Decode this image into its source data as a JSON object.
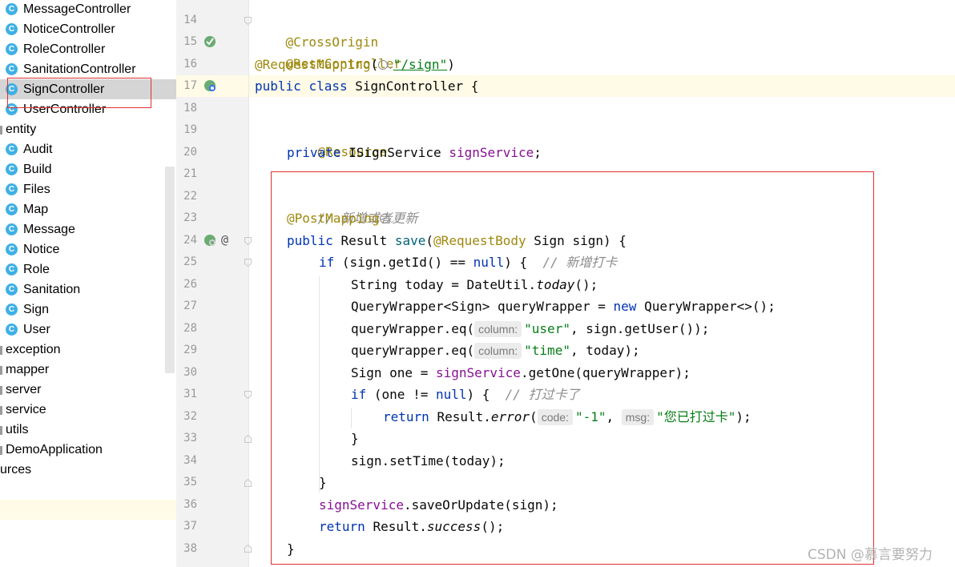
{
  "project_tree": {
    "items": [
      {
        "label": "MessageController",
        "kind": "class",
        "icon": "class-icon",
        "selected": false
      },
      {
        "label": "NoticeController",
        "kind": "class",
        "icon": "class-icon",
        "selected": false
      },
      {
        "label": "RoleController",
        "kind": "class",
        "icon": "class-icon",
        "selected": false
      },
      {
        "label": "SanitationController",
        "kind": "class",
        "icon": "class-icon",
        "selected": false
      },
      {
        "label": "SignController",
        "kind": "class",
        "icon": "class-icon",
        "selected": true
      },
      {
        "label": "UserController",
        "kind": "class",
        "icon": "class-icon",
        "selected": false
      },
      {
        "label": "entity",
        "kind": "package",
        "icon": "folder-icon",
        "selected": false
      },
      {
        "label": "Audit",
        "kind": "class",
        "icon": "class-icon",
        "selected": false
      },
      {
        "label": "Build",
        "kind": "class",
        "icon": "class-icon",
        "selected": false
      },
      {
        "label": "Files",
        "kind": "class",
        "icon": "class-icon",
        "selected": false
      },
      {
        "label": "Map",
        "kind": "class",
        "icon": "class-icon",
        "selected": false
      },
      {
        "label": "Message",
        "kind": "class",
        "icon": "class-icon",
        "selected": false
      },
      {
        "label": "Notice",
        "kind": "class",
        "icon": "class-icon",
        "selected": false
      },
      {
        "label": "Role",
        "kind": "class",
        "icon": "class-icon",
        "selected": false
      },
      {
        "label": "Sanitation",
        "kind": "class",
        "icon": "class-icon",
        "selected": false
      },
      {
        "label": "Sign",
        "kind": "class",
        "icon": "class-icon",
        "selected": false
      },
      {
        "label": "User",
        "kind": "class",
        "icon": "class-icon",
        "selected": false
      },
      {
        "label": "exception",
        "kind": "package",
        "icon": "folder-icon",
        "selected": false
      },
      {
        "label": "mapper",
        "kind": "package",
        "icon": "folder-icon",
        "selected": false
      },
      {
        "label": "server",
        "kind": "package",
        "icon": "folder-icon",
        "selected": false
      },
      {
        "label": "service",
        "kind": "package",
        "icon": "folder-icon",
        "selected": false
      },
      {
        "label": "utils",
        "kind": "package",
        "icon": "folder-icon",
        "selected": false
      },
      {
        "label": "DemoApplication",
        "kind": "app",
        "icon": "spring-app-icon",
        "selected": false
      },
      {
        "label": "urces",
        "kind": "package",
        "icon": "folder-icon",
        "selected": false
      }
    ],
    "class_icon_letter": "C"
  },
  "editor": {
    "line_numbers": [
      "14",
      "15",
      "16",
      "17",
      "18",
      "19",
      "20",
      "21",
      "22",
      "23",
      "24",
      "25",
      "26",
      "27",
      "28",
      "29",
      "30",
      "31",
      "32",
      "33",
      "34",
      "35",
      "36",
      "37",
      "38"
    ],
    "current_line": "17",
    "code": {
      "l14": {
        "annotation": "@CrossOrigin"
      },
      "l15": {
        "annotation": "@RestController"
      },
      "l16": {
        "annotation": "@RequestMapping",
        "open": "(",
        "path": "\"/sign\"",
        "close": ")"
      },
      "l17": {
        "kw1": "public",
        "kw2": "class",
        "name": "SignController",
        "brace": "{"
      },
      "l19": {
        "annotation": "@Resource"
      },
      "l20": {
        "kw": "private",
        "type": "ISignService",
        "field": "signService",
        "end": ";"
      },
      "l22": {
        "comment": "// 新增或者更新"
      },
      "l23": {
        "annotation": "@PostMapping"
      },
      "l24": {
        "kw": "public",
        "type": "Result",
        "method": "save",
        "open": "(",
        "param_ann": "@RequestBody",
        "params": "Sign sign) {"
      },
      "l25": {
        "kw": "if",
        "cond_a": "(sign.getId() == ",
        "null_kw": "null",
        "cond_b": ") {",
        "comment": "// 新增打卡"
      },
      "l26": {
        "decl": "String today = DateUtil.",
        "call": "today",
        "end": "();"
      },
      "l27": {
        "decl": "QueryWrapper<Sign> queryWrapper = ",
        "new_kw": "new",
        "rest": "QueryWrapper<>();"
      },
      "l28": {
        "prefix": "queryWrapper.eq(",
        "hint": "column:",
        "str": "\"user\"",
        "rest": ", sign.getUser());"
      },
      "l29": {
        "prefix": "queryWrapper.eq(",
        "hint": "column:",
        "str": "\"time\"",
        "rest": ", today);"
      },
      "l30": {
        "prefix": "Sign one = ",
        "field": "signService",
        "rest": ".getOne(queryWrapper);"
      },
      "l31": {
        "kw": "if",
        "cond_a": "(one != ",
        "null_kw": "null",
        "cond_b": ") {",
        "comment": "// 打过卡了"
      },
      "l32": {
        "kw": "return",
        "prefix": "Result.",
        "call": "error",
        "open": "(",
        "hint1": "code:",
        "str1": "\"-1\"",
        "sep": ",",
        "hint2": "msg:",
        "str2": "\"您已打过卡\"",
        "end": ");"
      },
      "l33": {
        "text": "}"
      },
      "l34": {
        "text": "sign.setTime(today);"
      },
      "l35": {
        "text": "}"
      },
      "l36": {
        "field": "signService",
        "rest": ".saveOrUpdate(sign);"
      },
      "l37": {
        "kw": "return",
        "prefix": "Result.",
        "call": "success",
        "end": "();"
      },
      "l38": {
        "text": "}"
      }
    }
  },
  "watermark": "CSDN @慕言要努力",
  "colors": {
    "annotation": "#9e880d",
    "keyword": "#0033b3",
    "field": "#871094",
    "string": "#067d17",
    "comment": "#8c8c8c",
    "highlight_box": "#e0302f",
    "class_icon": "#3fb0e5"
  }
}
